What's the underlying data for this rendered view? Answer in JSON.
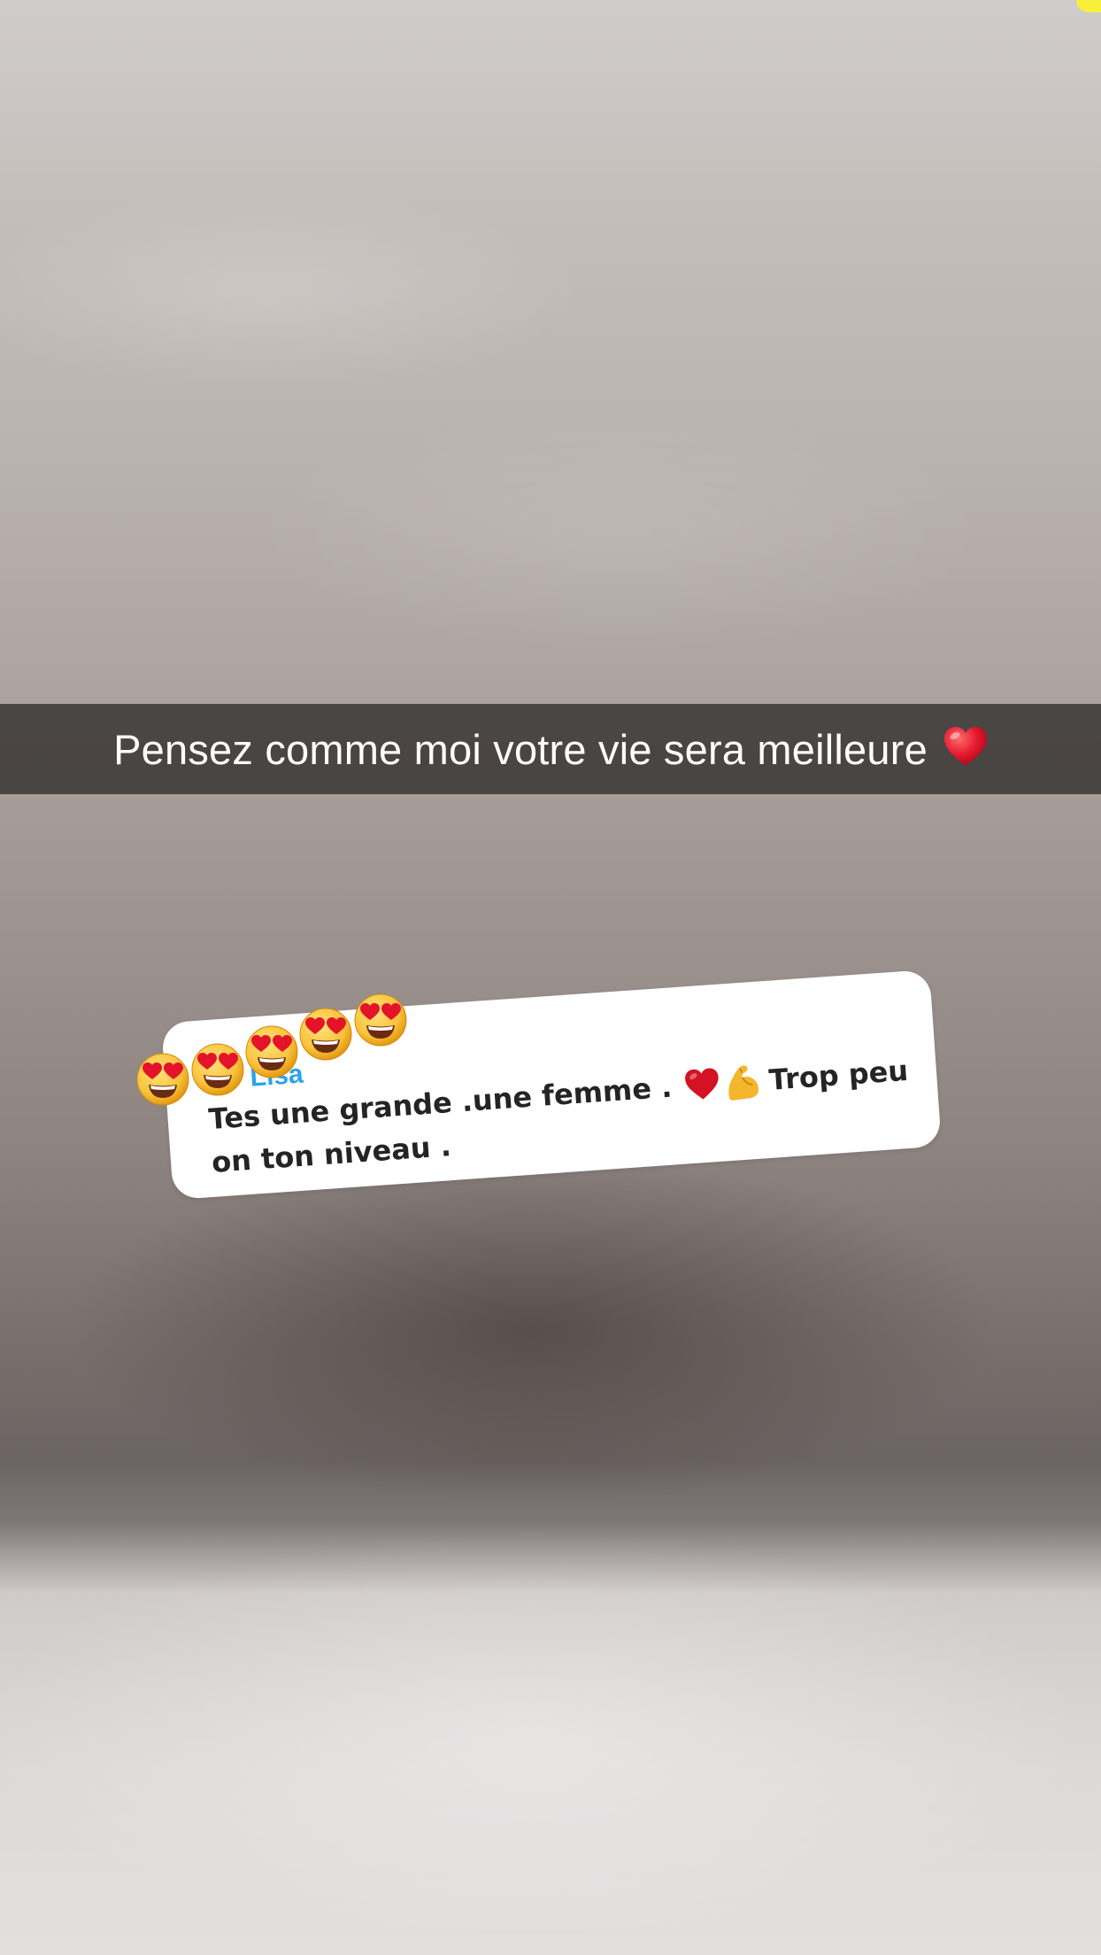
{
  "caption": {
    "text": "Pensez comme moi votre vie sera meilleure",
    "emoji": "red-heart-icon"
  },
  "reply": {
    "sender": "Lisa",
    "line1_before": "Tes une grande .une femme .",
    "line1_after": "Trop peu",
    "line2": "on ton niveau .",
    "inline_emojis": [
      "red-heart-icon",
      "flexed-biceps-icon"
    ]
  },
  "sticker": {
    "emoji": "heart-eyes-face-icon",
    "count": 5
  },
  "colors": {
    "caption_bar": "#282625",
    "caption_text": "#ffffff",
    "sender_name": "#2aa3ea",
    "reply_text": "#242424",
    "heart": "#e0142e",
    "face": "#f9c33c"
  }
}
